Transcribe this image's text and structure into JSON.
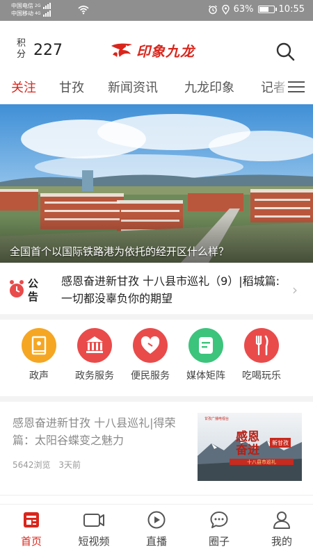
{
  "status_bar": {
    "carrier1": "中国电信",
    "carrier1_net": "2G",
    "carrier2": "中国移动",
    "carrier2_net": "4G",
    "battery_text": "63%",
    "battery_level": 0.63,
    "time": "10:55"
  },
  "header": {
    "points_label": "积分",
    "points_value": "227",
    "app_name": "印象九龙",
    "brand_color": "#d9261c"
  },
  "tabs": [
    {
      "label": "关注",
      "active": true
    },
    {
      "label": "甘孜",
      "active": false
    },
    {
      "label": "新闻资讯",
      "active": false
    },
    {
      "label": "九龙印象",
      "active": false
    },
    {
      "label": "记者",
      "active": false
    }
  ],
  "banner": {
    "caption": "全国首个以国际铁路港为依托的经开区什么样？"
  },
  "notice": {
    "icon_text_top": "公",
    "icon_text_bottom": "告",
    "text": "感恩奋进新甘孜 十八县市巡礼（9）|稻城篇:一切都没辜负你的期望"
  },
  "shortcuts": [
    {
      "label": "政声",
      "icon": "book-icon",
      "color": "#f5a623"
    },
    {
      "label": "政务服务",
      "icon": "government-building-icon",
      "color": "#e94b4b"
    },
    {
      "label": "便民服务",
      "icon": "heart-icon",
      "color": "#e94b4b"
    },
    {
      "label": "媒体矩阵",
      "icon": "document-icon",
      "color": "#3cc47c"
    },
    {
      "label": "吃喝玩乐",
      "icon": "fork-knife-icon",
      "color": "#e94b4b"
    }
  ],
  "article": {
    "title": "感恩奋进新甘孜 十八县巡礼|得荣篇：太阳谷蝶变之魅力",
    "views": "5642浏览",
    "time": "3天前",
    "thumb_top_text": "甘孜广播电视台",
    "thumb_title_1": "感恩",
    "thumb_title_2": "奋进",
    "thumb_badge": "新甘孜",
    "thumb_band_text": "十八县市巡礼"
  },
  "bottom_nav": [
    {
      "label": "首页",
      "icon": "home-icon",
      "active": true
    },
    {
      "label": "短视频",
      "icon": "video-camera-icon",
      "active": false
    },
    {
      "label": "直播",
      "icon": "play-circle-icon",
      "active": false
    },
    {
      "label": "圈子",
      "icon": "chat-bubble-icon",
      "active": false
    },
    {
      "label": "我的",
      "icon": "user-icon",
      "active": false
    }
  ]
}
